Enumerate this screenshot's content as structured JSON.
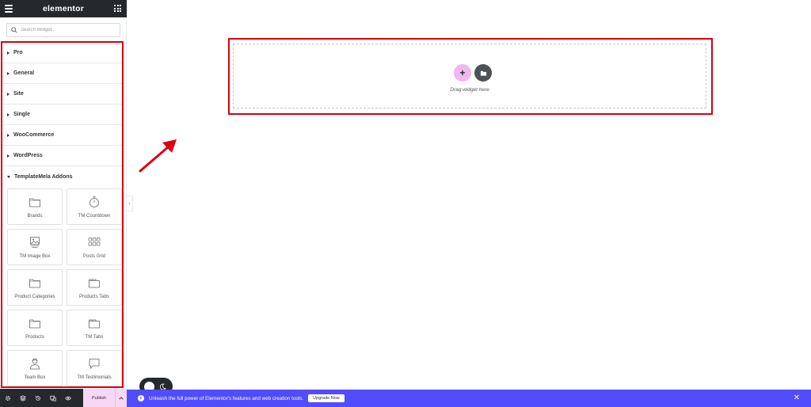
{
  "app": {
    "logo": "elementor"
  },
  "search": {
    "placeholder": "Search Widget..."
  },
  "categories": [
    {
      "label": "Pro"
    },
    {
      "label": "General"
    },
    {
      "label": "Site"
    },
    {
      "label": "Single"
    },
    {
      "label": "WooCommerce"
    },
    {
      "label": "WordPress"
    },
    {
      "label": "TemplateMela Addons"
    }
  ],
  "widgets": [
    {
      "label": "Brands",
      "icon": "folder-icon"
    },
    {
      "label": "TM Countdown",
      "icon": "stopwatch-icon"
    },
    {
      "label": "TM Image Box",
      "icon": "image-box-icon"
    },
    {
      "label": "Posts Grid",
      "icon": "grid-icon"
    },
    {
      "label": "Product Categories",
      "icon": "folder-icon"
    },
    {
      "label": "Products Tabs",
      "icon": "tabs-icon"
    },
    {
      "label": "Products",
      "icon": "folder-icon"
    },
    {
      "label": "TM Tabs",
      "icon": "tabs-icon"
    },
    {
      "label": "Team Box",
      "icon": "person-icon"
    },
    {
      "label": "TM Testimonials",
      "icon": "speech-bubble-icon"
    }
  ],
  "bottom": {
    "publish": "Publish"
  },
  "canvas": {
    "drag_text": "Drag widget here"
  },
  "promo": {
    "text": "Unleash the full power of Elementor's features and web creation tools.",
    "button": "Upgrade Now"
  },
  "colors": {
    "highlight": "#d9000f",
    "panel_dark": "#26292c",
    "promo": "#524cff",
    "accent_pink": "#f1b7ef"
  }
}
